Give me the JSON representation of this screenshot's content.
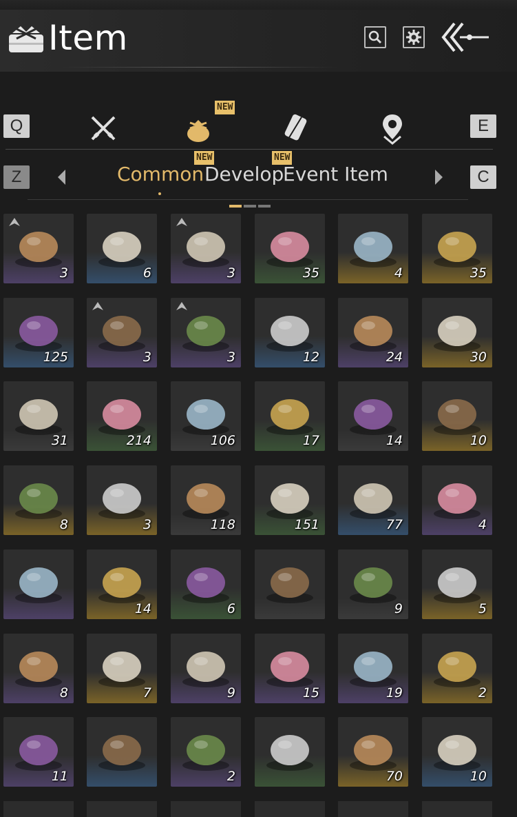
{
  "header": {
    "title": "Item",
    "icons": [
      "inventory-bag-icon",
      "search-icon",
      "gear-icon",
      "back-arrows-icon"
    ]
  },
  "categories": {
    "left_key": "Q",
    "right_key": "E",
    "tabs": [
      {
        "icon": "crossed-swords-icon",
        "active": false,
        "new": false
      },
      {
        "icon": "pouch-icon",
        "active": true,
        "new": true
      },
      {
        "icon": "scroll-quill-icon",
        "active": false,
        "new": false
      },
      {
        "icon": "location-pin-icon",
        "active": false,
        "new": false
      }
    ],
    "new_label": "NEW"
  },
  "subtabs": {
    "left_key": "Z",
    "right_key": "C",
    "items": [
      {
        "label": "Common",
        "active": true,
        "new": false
      },
      {
        "label": "Develop",
        "active": false,
        "new": true
      },
      {
        "label": "Event Item",
        "active": false,
        "new": true
      }
    ],
    "new_label": "NEW",
    "pages": 3,
    "current_page": 1
  },
  "colors": {
    "accent": "#e2b96a",
    "rarity_purple": "#5a4a7a",
    "rarity_gold": "#8a7030",
    "rarity_blue": "#3a5a7a",
    "rarity_green": "#3e5a3a"
  },
  "items": [
    {
      "name": "tea-cakes-plate",
      "count": "3",
      "rarity": "purple",
      "tag": true
    },
    {
      "name": "ceramic-jar",
      "count": "6",
      "rarity": "blue",
      "tag": false
    },
    {
      "name": "manual-pages",
      "count": "3",
      "rarity": "purple",
      "tag": true
    },
    {
      "name": "plum-blossom",
      "count": "35",
      "rarity": "green",
      "tag": false
    },
    {
      "name": "wind-essence",
      "count": "4",
      "rarity": "gold",
      "tag": false
    },
    {
      "name": "fox-coin",
      "count": "35",
      "rarity": "gold",
      "tag": false
    },
    {
      "name": "dye-box",
      "count": "125",
      "rarity": "blue",
      "tag": false
    },
    {
      "name": "manual-pages-2",
      "count": "3",
      "rarity": "purple",
      "tag": true
    },
    {
      "name": "manual-pages-3",
      "count": "3",
      "rarity": "purple",
      "tag": true
    },
    {
      "name": "dove-token",
      "count": "12",
      "rarity": "blue",
      "tag": false
    },
    {
      "name": "orb-pedestal",
      "count": "24",
      "rarity": "purple",
      "tag": false
    },
    {
      "name": "golden-card",
      "count": "30",
      "rarity": "gold",
      "tag": false
    },
    {
      "name": "cricket",
      "count": "31",
      "rarity": "gray",
      "tag": false
    },
    {
      "name": "bamboo-bundle",
      "count": "214",
      "rarity": "green",
      "tag": false
    },
    {
      "name": "firewood",
      "count": "106",
      "rarity": "gray",
      "tag": false
    },
    {
      "name": "lavender",
      "count": "17",
      "rarity": "green",
      "tag": false
    },
    {
      "name": "seed-sack",
      "count": "14",
      "rarity": "gray",
      "tag": false
    },
    {
      "name": "painted-bowl",
      "count": "10",
      "rarity": "gold",
      "tag": false
    },
    {
      "name": "rooster-bowl",
      "count": "8",
      "rarity": "gold",
      "tag": false
    },
    {
      "name": "white-bowl",
      "count": "3",
      "rarity": "gold",
      "tag": false
    },
    {
      "name": "mushrooms",
      "count": "118",
      "rarity": "gray",
      "tag": false
    },
    {
      "name": "lychee",
      "count": "151",
      "rarity": "green",
      "tag": false
    },
    {
      "name": "fish",
      "count": "77",
      "rarity": "blue",
      "tag": false
    },
    {
      "name": "wooden-chest",
      "count": "4",
      "rarity": "purple",
      "tag": false
    },
    {
      "name": "silk-pouch",
      "count": "",
      "rarity": "purple",
      "tag": false
    },
    {
      "name": "blossom-bowl",
      "count": "14",
      "rarity": "gold",
      "tag": false
    },
    {
      "name": "cloth-sack",
      "count": "6",
      "rarity": "green",
      "tag": false
    },
    {
      "name": "ore-stone",
      "count": "",
      "rarity": "gray",
      "tag": false
    },
    {
      "name": "red-agate",
      "count": "9",
      "rarity": "gray",
      "tag": false
    },
    {
      "name": "lidded-cup",
      "count": "5",
      "rarity": "gold",
      "tag": false
    },
    {
      "name": "silk-pouch-2",
      "count": "8",
      "rarity": "purple",
      "tag": false
    },
    {
      "name": "silk-pouch-3",
      "count": "7",
      "rarity": "gold",
      "tag": false
    },
    {
      "name": "lacquer-box",
      "count": "9",
      "rarity": "purple",
      "tag": false
    },
    {
      "name": "cloth-sack-2",
      "count": "15",
      "rarity": "purple",
      "tag": false
    },
    {
      "name": "mountain-emblem",
      "count": "19",
      "rarity": "purple",
      "tag": false
    },
    {
      "name": "red-envelope",
      "count": "2",
      "rarity": "gold",
      "tag": false
    },
    {
      "name": "jade-box",
      "count": "11",
      "rarity": "purple",
      "tag": false
    },
    {
      "name": "painting-scroll",
      "count": "",
      "rarity": "blue",
      "tag": false
    },
    {
      "name": "talisman-card",
      "count": "2",
      "rarity": "purple",
      "tag": false
    },
    {
      "name": "dark-talisman",
      "count": "",
      "rarity": "green",
      "tag": false
    },
    {
      "name": "bronze-bell",
      "count": "70",
      "rarity": "gold",
      "tag": false
    },
    {
      "name": "meatballs-plate",
      "count": "10",
      "rarity": "blue",
      "tag": false
    }
  ]
}
